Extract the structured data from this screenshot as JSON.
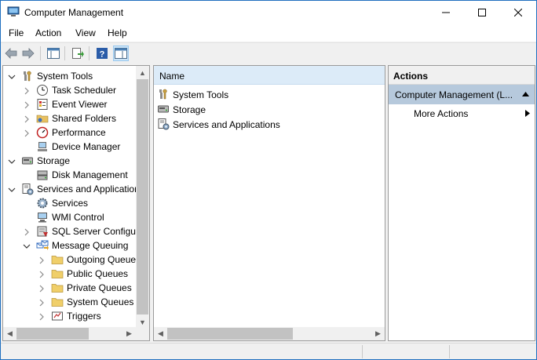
{
  "window": {
    "title": "Computer Management"
  },
  "menu": [
    "File",
    "Action",
    "View",
    "Help"
  ],
  "toolbar": {
    "buttons": [
      "back-icon",
      "forward-icon",
      "show-hide-console-tree-icon",
      "export-list-icon",
      "help-icon",
      "show-hide-action-pane-icon"
    ]
  },
  "tree": {
    "items": [
      {
        "label": "System Tools",
        "level": 0,
        "state": "expanded",
        "icon": "system-tools-icon"
      },
      {
        "label": "Task Scheduler",
        "level": 1,
        "state": "collapsed",
        "icon": "clock-icon"
      },
      {
        "label": "Event Viewer",
        "level": 1,
        "state": "collapsed",
        "icon": "event-viewer-icon"
      },
      {
        "label": "Shared Folders",
        "level": 1,
        "state": "collapsed",
        "icon": "shared-folder-icon"
      },
      {
        "label": "Performance",
        "level": 1,
        "state": "collapsed",
        "icon": "performance-icon"
      },
      {
        "label": "Device Manager",
        "level": 1,
        "state": "none",
        "icon": "device-manager-icon"
      },
      {
        "label": "Storage",
        "level": 0,
        "state": "expanded",
        "icon": "storage-icon"
      },
      {
        "label": "Disk Management",
        "level": 1,
        "state": "none",
        "icon": "disk-management-icon"
      },
      {
        "label": "Services and Applications",
        "level": 0,
        "state": "expanded",
        "icon": "services-apps-icon"
      },
      {
        "label": "Services",
        "level": 1,
        "state": "none",
        "icon": "services-gear-icon"
      },
      {
        "label": "WMI Control",
        "level": 1,
        "state": "none",
        "icon": "wmi-control-icon"
      },
      {
        "label": "SQL Server Configuration Manager",
        "level": 1,
        "state": "collapsed",
        "icon": "sql-server-icon"
      },
      {
        "label": "Message Queuing",
        "level": 1,
        "state": "expanded",
        "icon": "message-queuing-icon"
      },
      {
        "label": "Outgoing Queues",
        "level": 2,
        "state": "collapsed",
        "icon": "folder-icon"
      },
      {
        "label": "Public Queues",
        "level": 2,
        "state": "collapsed",
        "icon": "folder-icon"
      },
      {
        "label": "Private Queues",
        "level": 2,
        "state": "collapsed",
        "icon": "folder-icon"
      },
      {
        "label": "System Queues",
        "level": 2,
        "state": "collapsed",
        "icon": "folder-icon"
      },
      {
        "label": "Triggers",
        "level": 2,
        "state": "collapsed",
        "icon": "triggers-icon"
      }
    ]
  },
  "list": {
    "column": "Name",
    "rows": [
      {
        "label": "System Tools",
        "icon": "system-tools-icon"
      },
      {
        "label": "Storage",
        "icon": "storage-icon"
      },
      {
        "label": "Services and Applications",
        "icon": "services-apps-icon"
      }
    ]
  },
  "actions": {
    "header": "Actions",
    "section": "Computer Management (L...",
    "items": [
      "More Actions"
    ]
  },
  "colors": {
    "titlebar": "#ffffff",
    "column_header": "#dcebf8",
    "actions_section": "#b6c9dc",
    "window_border": "#1f6fbf"
  }
}
